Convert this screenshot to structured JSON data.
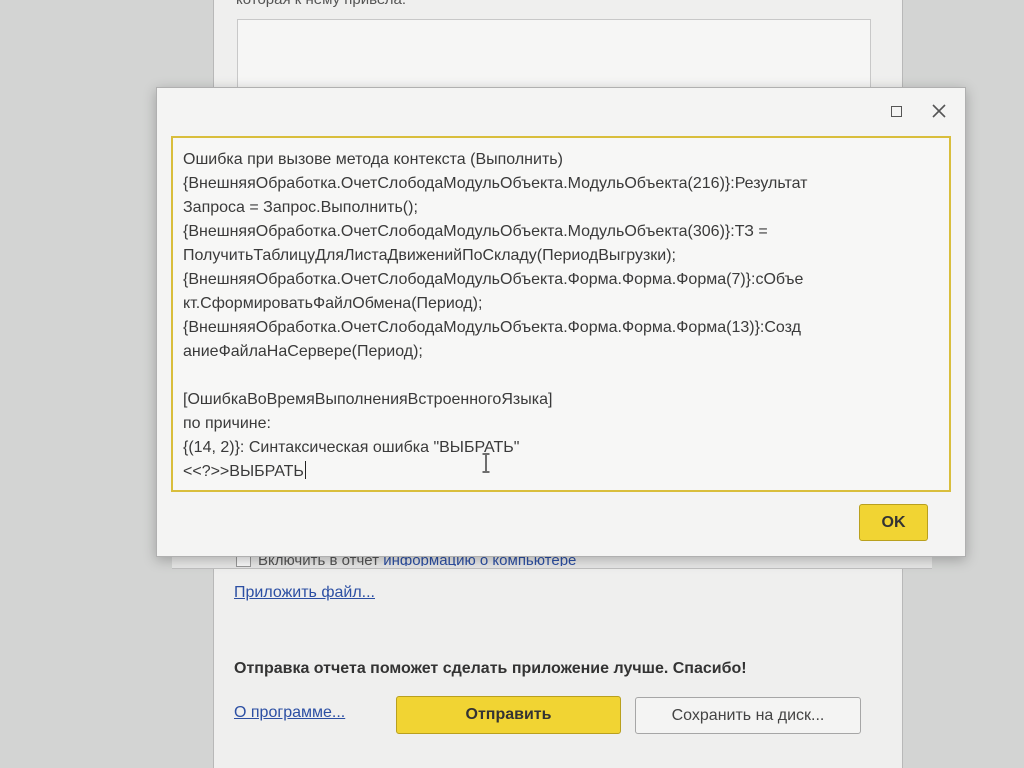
{
  "background_dialog": {
    "cut_text": "которая к нему привела:",
    "checkbox_label_prefix": "Включить в отчет",
    "checkbox_label_link": "информацию о компьютере",
    "attach_file_link": "Приложить файл...",
    "thanks_text": "Отправка отчета поможет сделать приложение лучше. Спасибо!",
    "about_link": "О программе...",
    "send_button": "Отправить",
    "save_button": "Сохранить на диск..."
  },
  "error_dialog": {
    "lines": [
      "Ошибка при вызове метода контекста (Выполнить)",
      "{ВнешняяОбработка.ОчетСлободаМодульОбъекта.МодульОбъекта(216)}:Результат",
      "Запроса = Запрос.Выполнить();",
      "{ВнешняяОбработка.ОчетСлободаМодульОбъекта.МодульОбъекта(306)}:ТЗ =",
      "ПолучитьТаблицуДляЛистаДвиженийПоСкладу(ПериодВыгрузки);",
      "{ВнешняяОбработка.ОчетСлободаМодульОбъекта.Форма.Форма.Форма(7)}:сОбъе",
      "кт.СформироватьФайлОбмена(Период);",
      "{ВнешняяОбработка.ОчетСлободаМодульОбъекта.Форма.Форма.Форма(13)}:Созд",
      "аниеФайлаНаСервере(Период);",
      "",
      "[ОшибкаВоВремяВыполненияВстроенногоЯзыка]",
      "по причине:",
      "{(14, 2)}: Синтаксическая ошибка \"ВЫБРАТЬ\"",
      "<<?>>ВЫБРАТЬ"
    ],
    "ok_button": "OK",
    "icons": {
      "maximize": "maximize-icon",
      "close": "close-icon"
    }
  },
  "colors": {
    "accent_yellow": "#f1d433",
    "link_blue": "#2c4fa3",
    "text_border": "#d9be3c"
  }
}
